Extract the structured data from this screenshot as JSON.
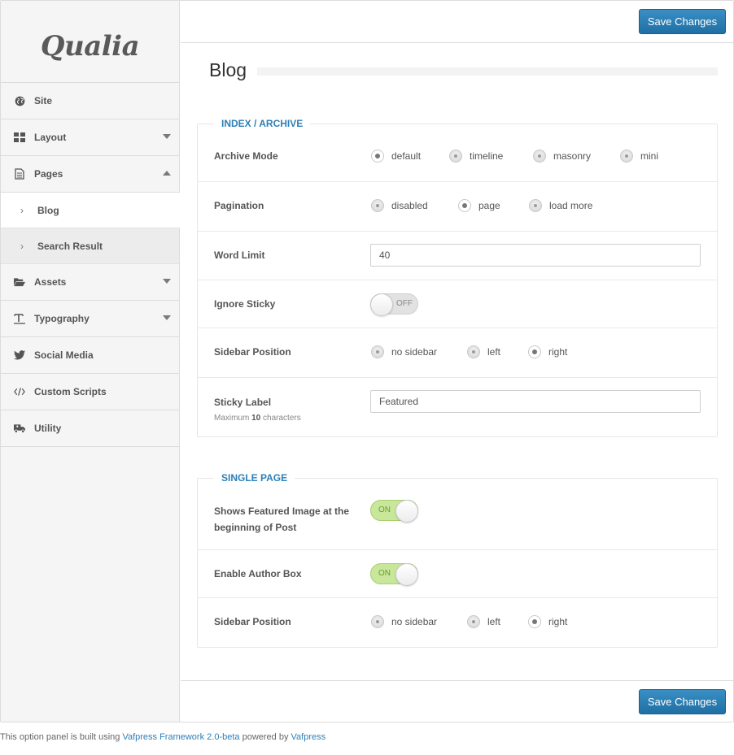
{
  "logo": "Qualia",
  "sidebar": {
    "items": [
      {
        "label": "Site",
        "icon": "globe-icon"
      },
      {
        "label": "Layout",
        "icon": "grid-icon"
      },
      {
        "label": "Pages",
        "icon": "document-icon"
      },
      {
        "label": "Assets",
        "icon": "folder-open-icon"
      },
      {
        "label": "Typography",
        "icon": "text-height-icon"
      },
      {
        "label": "Social Media",
        "icon": "twitter-icon"
      },
      {
        "label": "Custom Scripts",
        "icon": "code-icon"
      },
      {
        "label": "Utility",
        "icon": "truck-icon"
      }
    ],
    "sub_items": [
      {
        "label": "Blog",
        "active": true
      },
      {
        "label": "Search Result",
        "active": false
      }
    ]
  },
  "toolbar": {
    "save_label": "Save Changes"
  },
  "page": {
    "title": "Blog"
  },
  "index_archive": {
    "legend": "INDEX / ARCHIVE",
    "archive_mode": {
      "label": "Archive Mode",
      "options": [
        "default",
        "timeline",
        "masonry",
        "mini"
      ],
      "selected": "default"
    },
    "pagination": {
      "label": "Pagination",
      "options": [
        "disabled",
        "page",
        "load more"
      ],
      "selected": "page"
    },
    "word_limit": {
      "label": "Word Limit",
      "value": "40"
    },
    "ignore_sticky": {
      "label": "Ignore Sticky",
      "state": "OFF"
    },
    "sidebar_position": {
      "label": "Sidebar Position",
      "options": [
        "no sidebar",
        "left",
        "right"
      ],
      "selected": "right"
    },
    "sticky_label": {
      "label": "Sticky Label",
      "desc_prefix": "Maximum",
      "desc_value": "10",
      "desc_suffix": "characters",
      "value": "Featured"
    }
  },
  "single_page": {
    "legend": "SINGLE PAGE",
    "featured_image": {
      "label_line1": "Shows Featured Image at the",
      "label_line2": "beginning of Post",
      "state": "ON"
    },
    "author_box": {
      "label": "Enable Author Box",
      "state": "ON"
    },
    "sidebar_position": {
      "label": "Sidebar Position",
      "options": [
        "no sidebar",
        "left",
        "right"
      ],
      "selected": "right"
    }
  },
  "footer": {
    "prefix": "This option panel is built using",
    "link1": "Vafpress Framework 2.0-beta",
    "middle": "powered by",
    "link2": "Vafpress"
  },
  "colors": {
    "accent": "#2d7fb8",
    "button": "#2a80b9",
    "toggle_on": "#c9e79a"
  }
}
